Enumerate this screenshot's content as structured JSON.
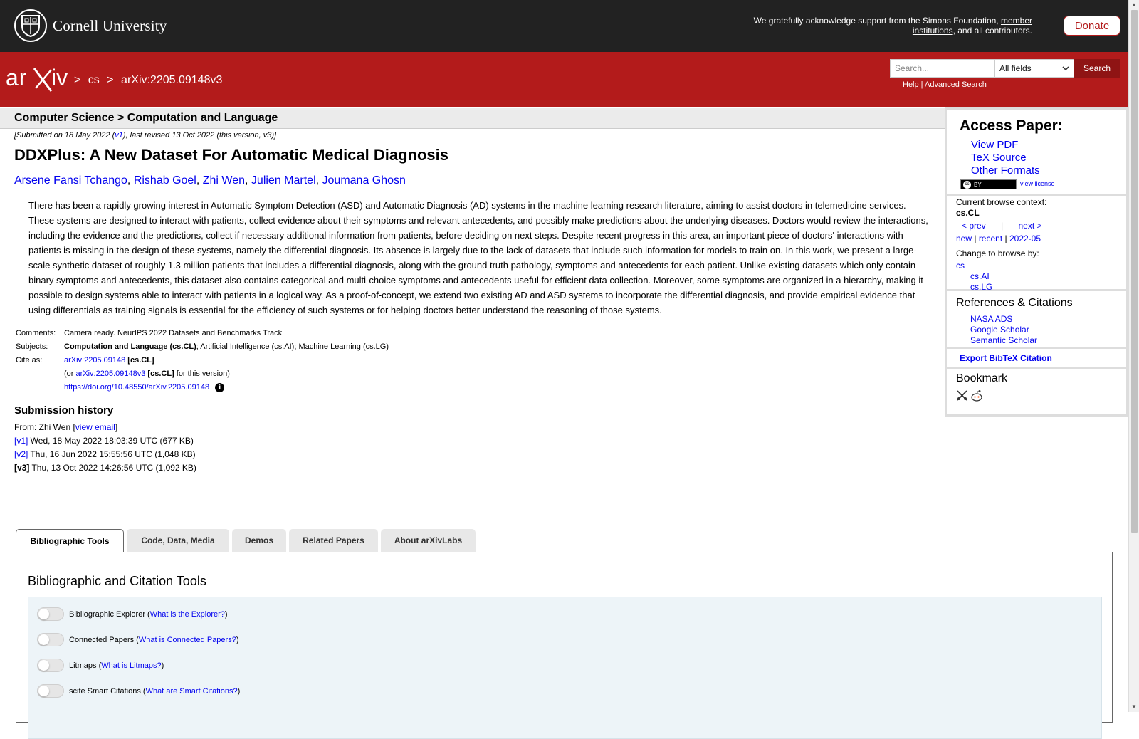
{
  "header": {
    "university": "Cornell University",
    "support_text": "We gratefully acknowledge support from the Simons Foundation,",
    "member_link": "member institutions",
    "support_suffix": ", and all contributors.",
    "donate_label": "Donate"
  },
  "arxiv_bar": {
    "logo_text": "arXiv",
    "breadcrumb": [
      ">",
      "cs",
      ">",
      "arXiv:2205.09148v3"
    ],
    "search_placeholder": "Search...",
    "field_select": "All fields",
    "search_button": "Search",
    "help_link": "Help",
    "separator": " | ",
    "advanced_link": "Advanced Search"
  },
  "subheader": {
    "title": "Computer Science > Computation and Language"
  },
  "paper": {
    "dateline_prefix": "[Submitted on 18 May 2022 (",
    "dateline_v1": "v1",
    "dateline_suffix": "), last revised 13 Oct 2022 (this version, v3)]",
    "title": "DDXPlus: A New Dataset For Automatic Medical Diagnosis",
    "authors": [
      "Arsene Fansi Tchango",
      "Rishab Goel",
      "Zhi Wen",
      "Julien Martel",
      "Joumana Ghosn"
    ],
    "abstract": "There has been a rapidly growing interest in Automatic Symptom Detection (ASD) and Automatic Diagnosis (AD) systems in the machine learning research literature, aiming to assist doctors in telemedicine services. These systems are designed to interact with patients, collect evidence about their symptoms and relevant antecedents, and possibly make predictions about the underlying diseases. Doctors would review the interactions, including the evidence and the predictions, collect if necessary additional information from patients, before deciding on next steps. Despite recent progress in this area, an important piece of doctors' interactions with patients is missing in the design of these systems, namely the differential diagnosis. Its absence is largely due to the lack of datasets that include such information for models to train on. In this work, we present a large-scale synthetic dataset of roughly 1.3 million patients that includes a differential diagnosis, along with the ground truth pathology, symptoms and antecedents for each patient. Unlike existing datasets which only contain binary symptoms and antecedents, this dataset also contains categorical and multi-choice symptoms and antecedents useful for efficient data collection. Moreover, some symptoms are organized in a hierarchy, making it possible to design systems able to interact with patients in a logical way. As a proof-of-concept, we extend two existing AD and ASD systems to incorporate the differential diagnosis, and provide empirical evidence that using differentials as training signals is essential for the efficiency of such systems or for helping doctors better understand the reasoning of those systems.",
    "comments_label": "Comments:",
    "comments": "Camera ready. NeurIPS 2022 Datasets and Benchmarks Track",
    "subjects_label": "Subjects:",
    "subjects_primary": "Computation and Language (cs.CL)",
    "subjects_rest": "; Artificial Intelligence (cs.AI); Machine Learning (cs.LG)",
    "cite_label": "Cite as:",
    "cite_id": "arXiv:2205.09148",
    "cite_tag": "[cs.CL]",
    "cite_or": "(or ",
    "cite_version": "arXiv:2205.09148v3",
    "cite_version_tag": "[cs.CL]",
    "cite_version_suffix": " for this version)",
    "doi": "https://doi.org/10.48550/arXiv.2205.09148",
    "doi_info": "i"
  },
  "history": {
    "title": "Submission history",
    "from_prefix": "From: Zhi Wen [",
    "view_email": "view email",
    "from_suffix": "]",
    "versions": [
      {
        "label": "[v1]",
        "text": " Wed, 18 May 2022 18:03:39 UTC (677 KB)"
      },
      {
        "label": "[v2]",
        "text": " Thu, 16 Jun 2022 15:55:56 UTC (1,048 KB)"
      },
      {
        "label": "[v3]",
        "text": " Thu, 13 Oct 2022 14:26:56 UTC (1,092 KB)"
      }
    ]
  },
  "sidebar": {
    "access_title": "Access Paper:",
    "access_links": [
      "View PDF",
      "TeX Source",
      "Other Formats"
    ],
    "cc_label": "BY",
    "cc_symbol": "cc",
    "view_license": "view license",
    "browse_context_label": "Current browse context:",
    "browse_context": "cs.CL",
    "prev": "< prev",
    "pipe": "|",
    "next": "next >",
    "new": "new",
    "recent": "recent",
    "month": "2022-05",
    "change_browse": "Change to browse by:",
    "browse_cs": "cs",
    "browse_ai": "cs.AI",
    "browse_lg": "cs.LG",
    "refs_title": "References & Citations",
    "refs_links": [
      "NASA ADS",
      "Google Scholar",
      "Semantic Scholar"
    ],
    "export": "Export BibTeX Citation",
    "bookmark_title": "Bookmark"
  },
  "tabs": {
    "items": [
      "Bibliographic Tools",
      "Code, Data, Media",
      "Demos",
      "Related Papers",
      "About arXivLabs"
    ],
    "panel_title": "Bibliographic and Citation Tools",
    "tools": [
      {
        "name": "Bibliographic Explorer",
        "link": "What is the Explorer?"
      },
      {
        "name": "Connected Papers",
        "link": "What is Connected Papers?"
      },
      {
        "name": "Litmaps",
        "link": "What is Litmaps?"
      },
      {
        "name": "scite Smart Citations",
        "link": "What are Smart Citations?"
      }
    ]
  },
  "colors": {
    "arxiv_red": "#b31b1b",
    "top_bar": "#222222",
    "link": "#0000ee"
  }
}
